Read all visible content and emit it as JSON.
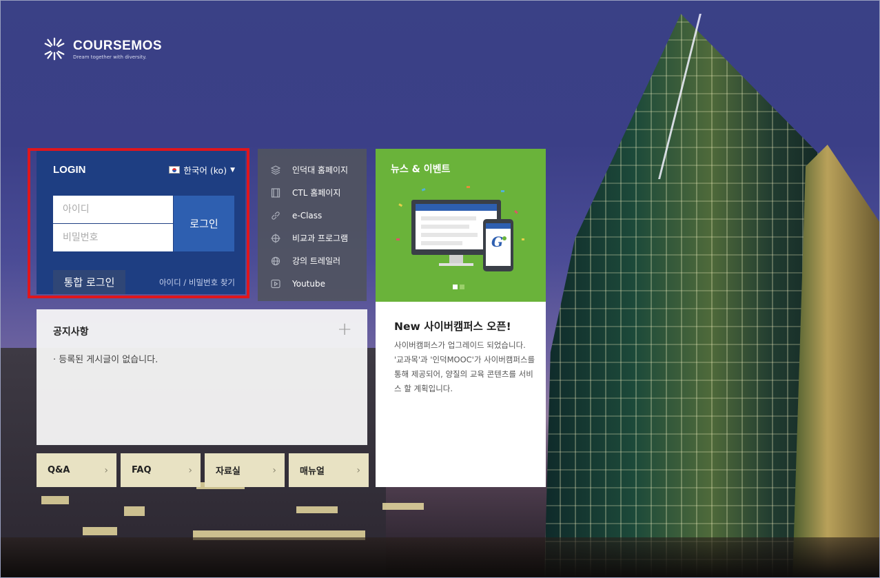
{
  "logo": {
    "name": "COURSEMOS",
    "tagline": "Dream together with diversity."
  },
  "login": {
    "title": "LOGIN",
    "language": "한국어 (ko)",
    "id_placeholder": "아이디",
    "password_placeholder": "비밀번호",
    "login_button": "로그인",
    "sso_button": "통합 로그인",
    "find_link": "아이디 / 비밀번호 찾기"
  },
  "quick_links": [
    {
      "label": "인덕대 홈페이지",
      "icon": "layers-icon"
    },
    {
      "label": "CTL 홈페이지",
      "icon": "film-icon"
    },
    {
      "label": "e-Class",
      "icon": "link-icon"
    },
    {
      "label": "비교과 프로그램",
      "icon": "crosshair-icon"
    },
    {
      "label": "강의 트레일러",
      "icon": "globe-icon"
    },
    {
      "label": "Youtube",
      "icon": "play-icon"
    }
  ],
  "news": {
    "header": "뉴스 & 이벤트",
    "title": "New 사이버캠퍼스 오픈!",
    "body": "사이버캠퍼스가 업그레이드 되었습니다. '교과목'과 '인덕MOOC'가 사이버캠퍼스를 통해 제공되어, 양질의 교육 콘텐츠를 서비스 할 계획입니다.",
    "slide_count": 2,
    "active_slide": 1
  },
  "notice": {
    "title": "공지사항",
    "empty_message": "· 등록된 게시글이 없습니다."
  },
  "tiles": [
    {
      "label": "Q&A"
    },
    {
      "label": "FAQ"
    },
    {
      "label": "자료실"
    },
    {
      "label": "매뉴얼"
    }
  ],
  "colors": {
    "login_bg": "#1e3e82",
    "login_button": "#2e5fb0",
    "highlight_outline": "#e0161c",
    "news_green": "#6ab33a",
    "tile_bg": "#e8e2c3"
  }
}
